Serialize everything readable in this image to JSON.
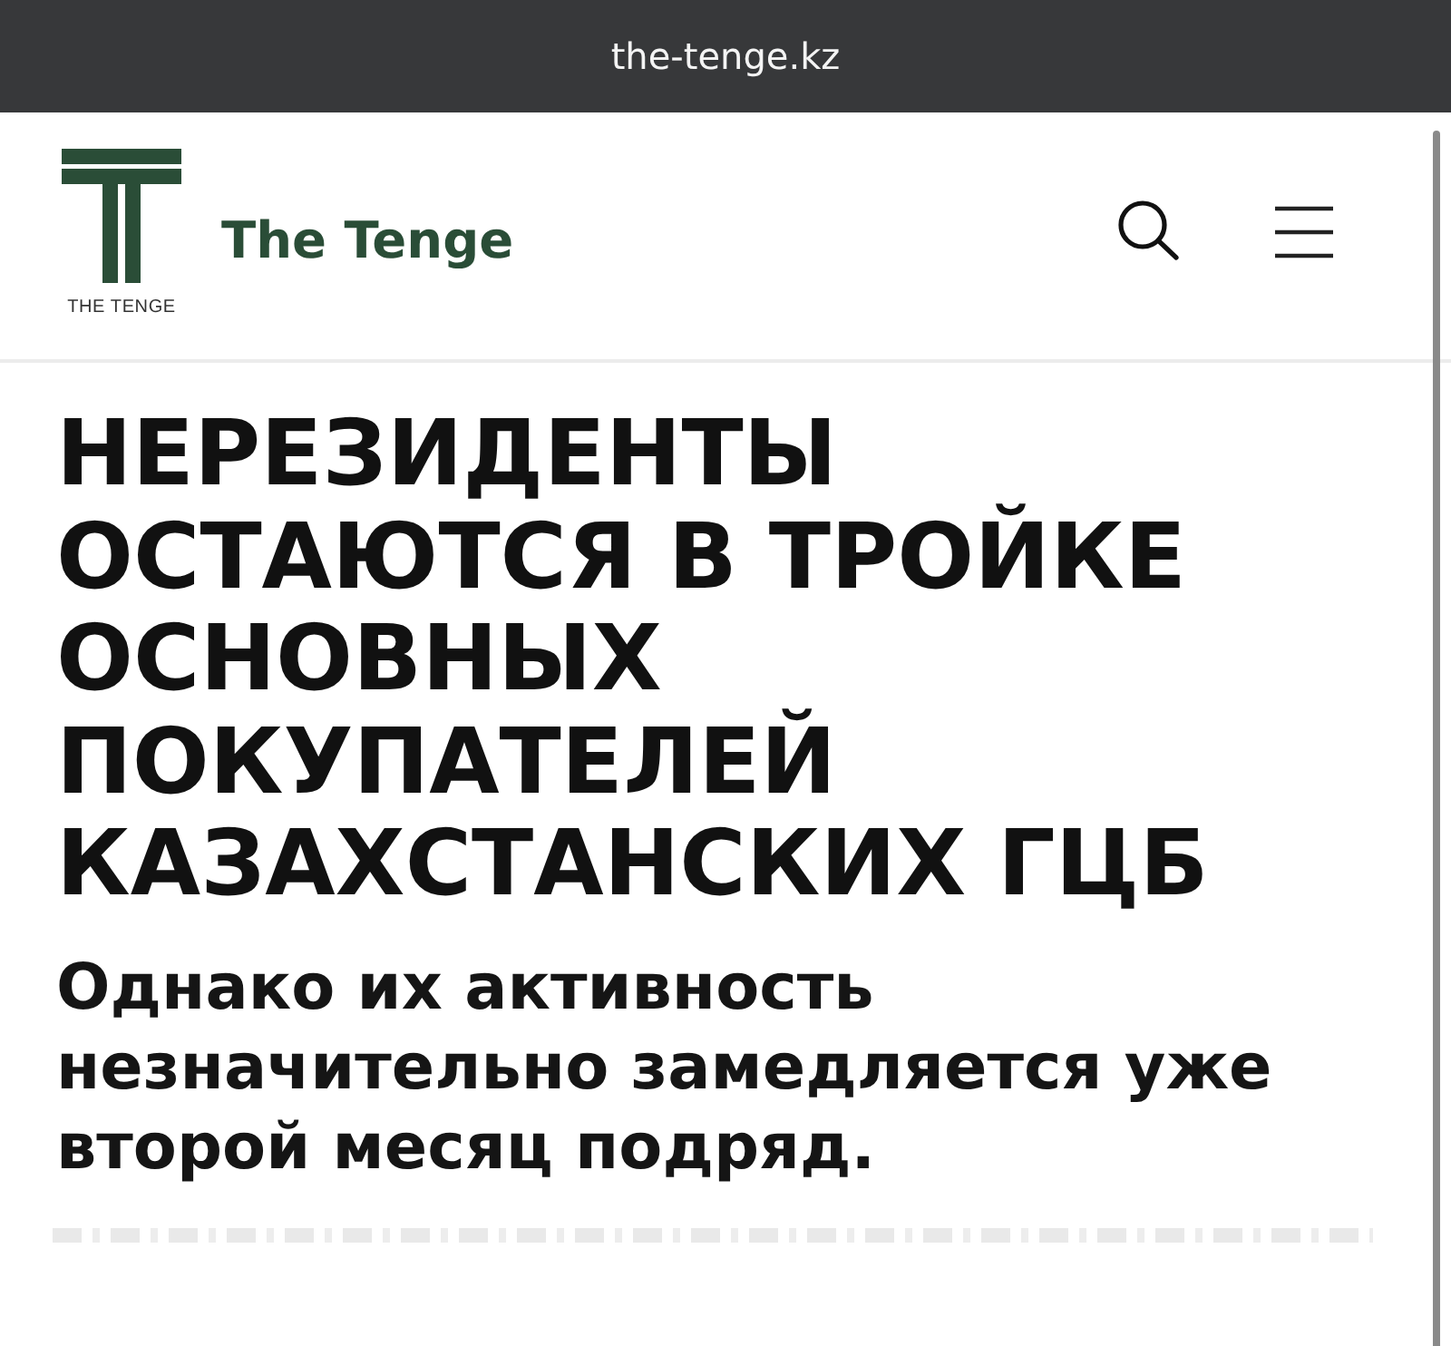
{
  "browser_bar": {
    "url": "the-tenge.kz"
  },
  "header": {
    "logo_caption": "THE TENGE",
    "site_name": "The Tenge"
  },
  "article": {
    "title": "НЕРЕЗИДЕНТЫ ОСТАЮТСЯ В ТРОЙКЕ ОСНОВНЫХ ПОКУПАТЕЛЕЙ КАЗАХСТАНСКИХ ГЦБ",
    "subtitle": "Однако их активность незначительно замедляется уже второй месяц подряд."
  }
}
